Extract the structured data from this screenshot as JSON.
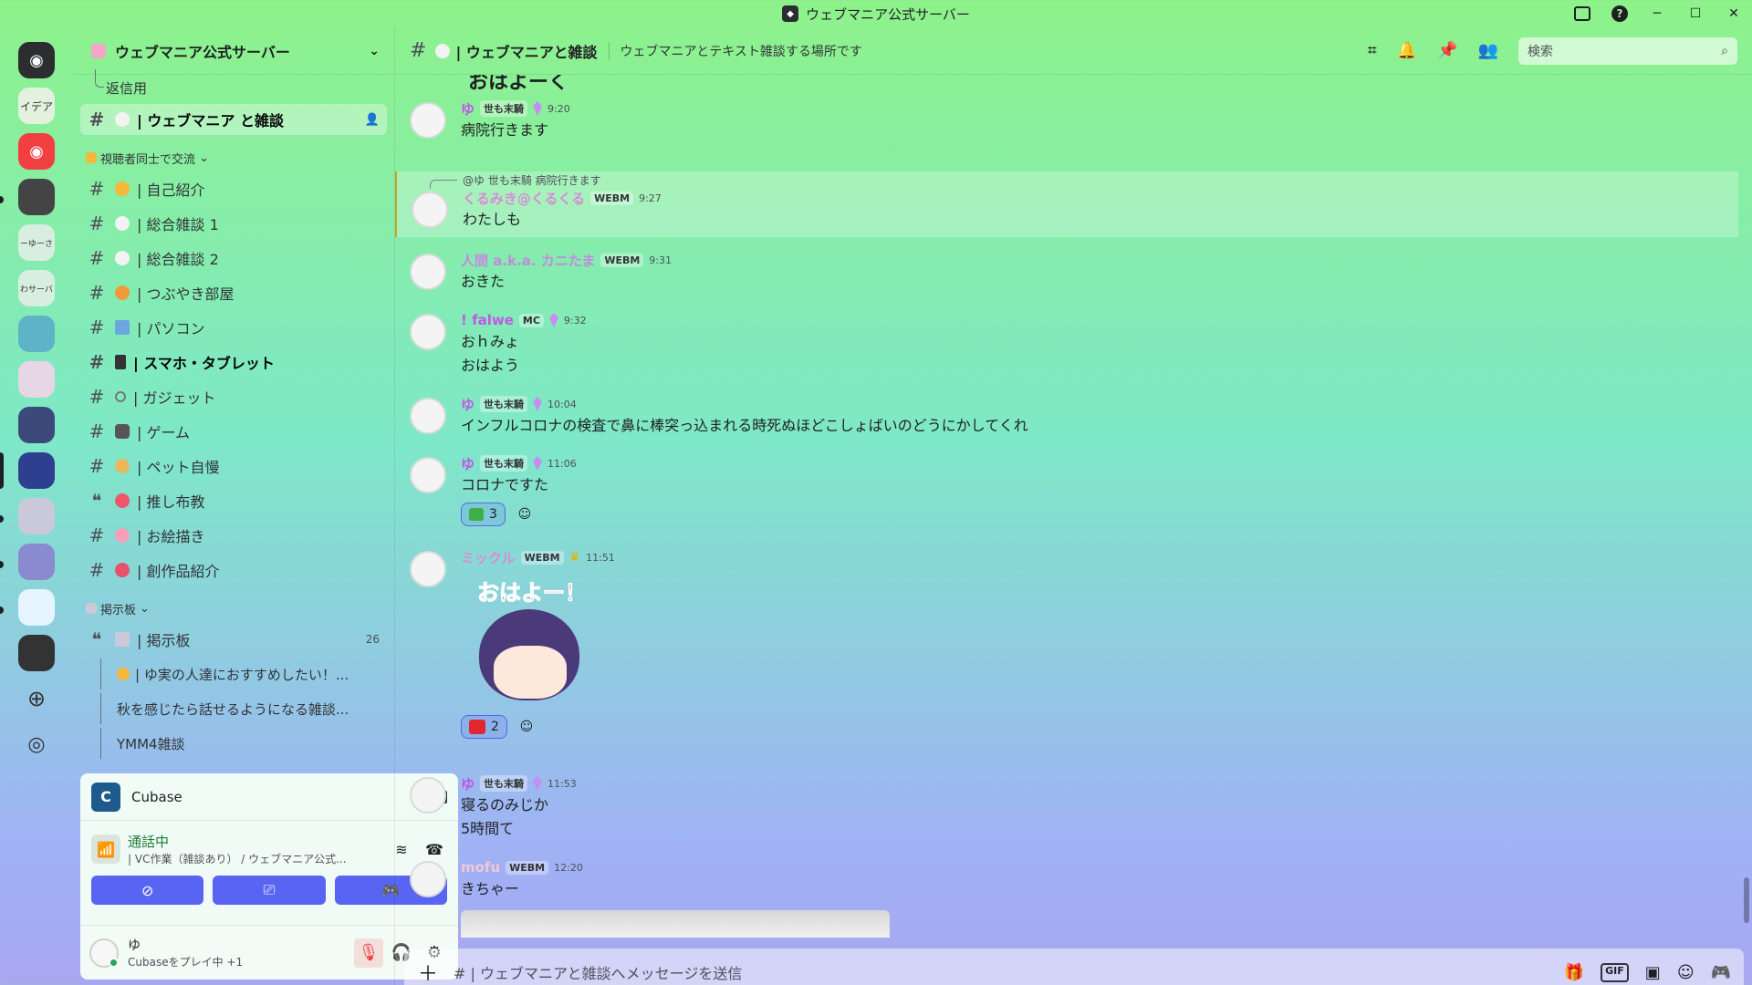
{
  "window": {
    "title": "ウェブマニア公式サーバー"
  },
  "rail": {
    "servers": [
      {
        "label": "",
        "icon": "discord-home-icon",
        "color": "#2b2d31"
      },
      {
        "label": "イデア",
        "icon": "",
        "color": "#e3f2df"
      },
      {
        "label": "",
        "icon": "discord-icon",
        "color": "#f23f42"
      },
      {
        "label": "",
        "icon": "",
        "color": "#444"
      },
      {
        "label": "ーゆーさ",
        "icon": "",
        "color": "#d8efe0"
      },
      {
        "label": "わサーバ",
        "icon": "",
        "color": "#d8efe0"
      },
      {
        "label": "",
        "icon": "",
        "color": "#5fb3c7"
      },
      {
        "label": "",
        "icon": "",
        "color": "#e6d6e6"
      },
      {
        "label": "",
        "icon": "",
        "color": "#3b4a7a"
      },
      {
        "label": "",
        "icon": "",
        "color": "#2e3f8f"
      },
      {
        "label": "",
        "icon": "",
        "color": "#c9c9d9"
      },
      {
        "label": "",
        "icon": "",
        "color": "#8a8ad0"
      },
      {
        "label": "",
        "icon": "",
        "color": "#e6f4ff"
      },
      {
        "label": "",
        "icon": "",
        "color": "#333"
      }
    ]
  },
  "sidebar": {
    "server_name": "ウェブマニア公式サーバー",
    "reply_thread": "返信用",
    "active_channel": "| ウェブマニア と雑談",
    "category1": "視聴者同士で交流",
    "channels": [
      {
        "name": "| 自己紹介",
        "emo": "#f7b73a"
      },
      {
        "name": "| 総合雑談 1",
        "emo": "#f3f3f3"
      },
      {
        "name": "| 総合雑談 2",
        "emo": "#f3f3f3"
      },
      {
        "name": "| つぶやき部屋",
        "emo": "#f29a3a"
      },
      {
        "name": "| パソコン",
        "emo": "#6aa7e0"
      },
      {
        "name": "| スマホ・タブレット",
        "emo": "#333"
      },
      {
        "name": "| ガジェット",
        "emo": "#999"
      },
      {
        "name": "| ゲーム",
        "emo": "#555"
      },
      {
        "name": "| ペット自慢",
        "emo": "#e8b860"
      },
      {
        "name": "| 推し布教",
        "emo": "#f2556b"
      },
      {
        "name": "| お絵描き",
        "emo": "#f3a0b8"
      },
      {
        "name": "| 創作品紹介",
        "emo": "#e8506e"
      }
    ],
    "category2": "掲示板",
    "forum": {
      "name": "| 掲示板",
      "count": "26"
    },
    "threads": [
      "| ゆ実の人達におすすめしたい！...",
      "秋を感じたら話せるようになる雑談...",
      "YMM4雑談"
    ]
  },
  "panel": {
    "activity_name": "Cubase",
    "voice_status": "通話中",
    "voice_channel": "| VC作業（雑談あり） / ウェブマニア公式...",
    "user_name": "ゆ",
    "user_activity": "Cubaseをプレイ中 +1"
  },
  "chat": {
    "channel_title": "| ウェブマニアと雑談",
    "topic": "ウェブマニアとテキスト雑談する場所です",
    "search_placeholder": "検索",
    "partial_top": "おはよーく",
    "composer_placeholder": "#  | ウェブマニアと雑談へメッセージを送信",
    "messages": [
      {
        "user": "ゆ",
        "user_color": "#c158e8",
        "tag": "世も末騎",
        "time": "9:20",
        "lines": [
          "病院行きます"
        ]
      },
      {
        "reply_to": "@ゆ  世も末騎  病院行きます",
        "user": "くるみき@くるくる",
        "user_color": "#d98bd8",
        "tag": "WEBM",
        "time": "9:27",
        "lines": [
          "わたしも"
        ]
      },
      {
        "user": "人間 a.k.a. カニたま",
        "user_color": "#c38ae0",
        "tag": "WEBM",
        "time": "9:31",
        "lines": [
          "おきた"
        ]
      },
      {
        "user": "! falwe",
        "user_color": "#c158e8",
        "tag": "MC",
        "time": "9:32",
        "lines": [
          "おｈみょ",
          "おはよう"
        ]
      },
      {
        "user": "ゆ",
        "user_color": "#c158e8",
        "tag": "世も末騎",
        "time": "10:04",
        "lines": [
          "インフルコロナの検査で鼻に棒突っ込まれる時死ぬほどこしょばいのどうにかしてくれ"
        ]
      },
      {
        "user": "ゆ",
        "user_color": "#c158e8",
        "tag": "世も末騎",
        "time": "11:06",
        "lines": [
          "コロナですた"
        ],
        "reaction_count": "3"
      },
      {
        "user": "ミックル",
        "user_color": "#d98bd8",
        "tag": "WEBM",
        "time": "11:51",
        "sticker_text": "おはよー！",
        "reaction_count": "2"
      },
      {
        "user": "ゆ",
        "user_color": "#c158e8",
        "tag": "世も末騎",
        "time": "11:53",
        "lines": [
          "寝るのみじか",
          "5時間て"
        ]
      },
      {
        "user": "mofu",
        "user_color": "#f0c8d8",
        "tag": "WEBM",
        "time": "12:20",
        "lines": [
          "きちゃー"
        ]
      }
    ]
  }
}
